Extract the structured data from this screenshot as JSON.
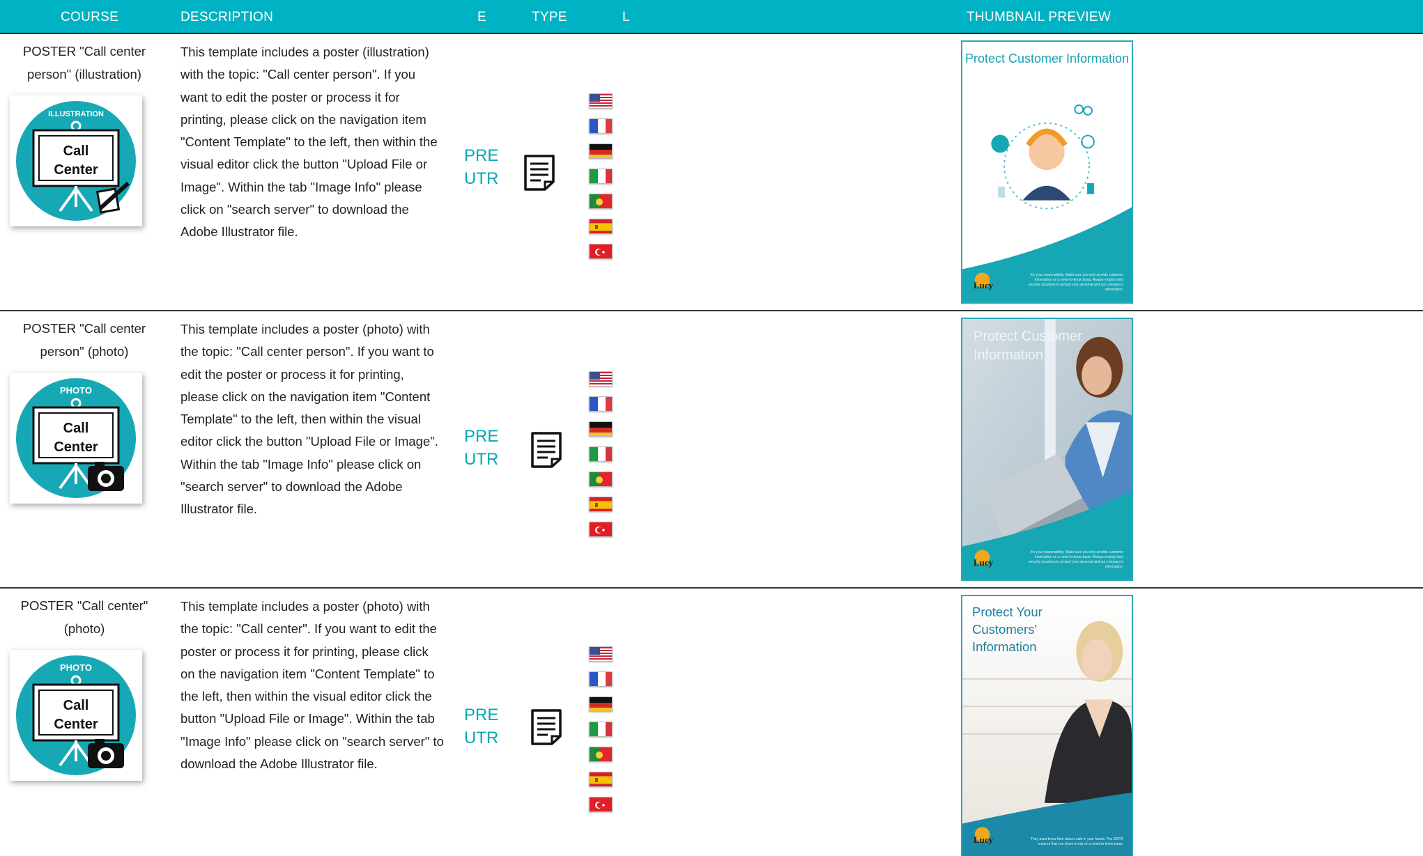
{
  "header": {
    "course": "COURSE",
    "description": "DESCRIPTION",
    "e": "E",
    "type": "TYPE",
    "l": "L",
    "thumbnail": "THUMBNAIL PREVIEW"
  },
  "rows": [
    {
      "title": "POSTER \"Call center person\" (illustration)",
      "icon_tag": "ILLUSTRATION",
      "icon_text_1": "Call",
      "icon_text_2": "Center",
      "icon_badge": "pencil-icon",
      "description": "This template includes a poster (illustration) with the topic: \"Call center person\". If you want to edit the poster or process it for printing, please click on the navigation item \"Content Template\" to the left, then within the visual editor click the button \"Upload File or Image\". Within the tab \"Image Info\" please click on \"search server\" to download the Adobe Illustrator file.",
      "e_line1": "PRE",
      "e_line2": "UTR",
      "type_icon": "document-icon",
      "languages": [
        "en-us",
        "fr",
        "de",
        "it",
        "pt",
        "es",
        "tr"
      ],
      "thumb_title": "Protect Customer Information",
      "thumb_brand": "Lucy",
      "thumb_text": "It's your responsibility. Make sure you only provide customer information on a need-to-know basis. Always employ best security practices to protect your personal and our company's information."
    },
    {
      "title": "POSTER \"Call center person\" (photo)",
      "icon_tag": "PHOTO",
      "icon_text_1": "Call",
      "icon_text_2": "Center",
      "icon_badge": "camera-icon",
      "description": "This template includes a poster (photo) with the topic: \"Call center person\". If you want to edit the poster or process it for printing, please click on the navigation item \"Content Template\" to the left, then within the visual editor click the button \"Upload File or Image\". Within the tab \"Image Info\" please click on \"search server\" to download the Adobe Illustrator file.",
      "e_line1": "PRE",
      "e_line2": "UTR",
      "type_icon": "document-icon",
      "languages": [
        "en-us",
        "fr",
        "de",
        "it",
        "pt",
        "es",
        "tr"
      ],
      "thumb_title": "Protect Customer Information",
      "thumb_brand": "Lucy",
      "thumb_text": "It's your responsibility. Make sure you only provide customer information on a need-to-know basis. Always employ best security practices to protect your personal and our company's information."
    },
    {
      "title": "POSTER \"Call center\" (photo)",
      "icon_tag": "PHOTO",
      "icon_text_1": "Call",
      "icon_text_2": "Center",
      "icon_badge": "camera-icon",
      "description": "This template includes a poster (photo) with the topic: \"Call center\". If you want to edit the poster or process it for printing, please click on the navigation item \"Content Template\" to the left, then within the visual editor click the button \"Upload File or Image\". Within the tab \"Image Info\" please click on \"search server\" to download the Adobe Illustrator file.",
      "e_line1": "PRE",
      "e_line2": "UTR",
      "type_icon": "document-icon",
      "languages": [
        "en-us",
        "fr",
        "de",
        "it",
        "pt",
        "es",
        "tr"
      ],
      "thumb_title": "Protect Your Customers' Information",
      "thumb_brand": "Lucy",
      "thumb_text": "They must know their data is safe in your hands. The GDPR requires that you share it only on a need-to-know basis."
    }
  ],
  "colors": {
    "accent": "#00b3c4",
    "e_text": "#00a7b8",
    "icon_circle": "#16a9b5"
  }
}
